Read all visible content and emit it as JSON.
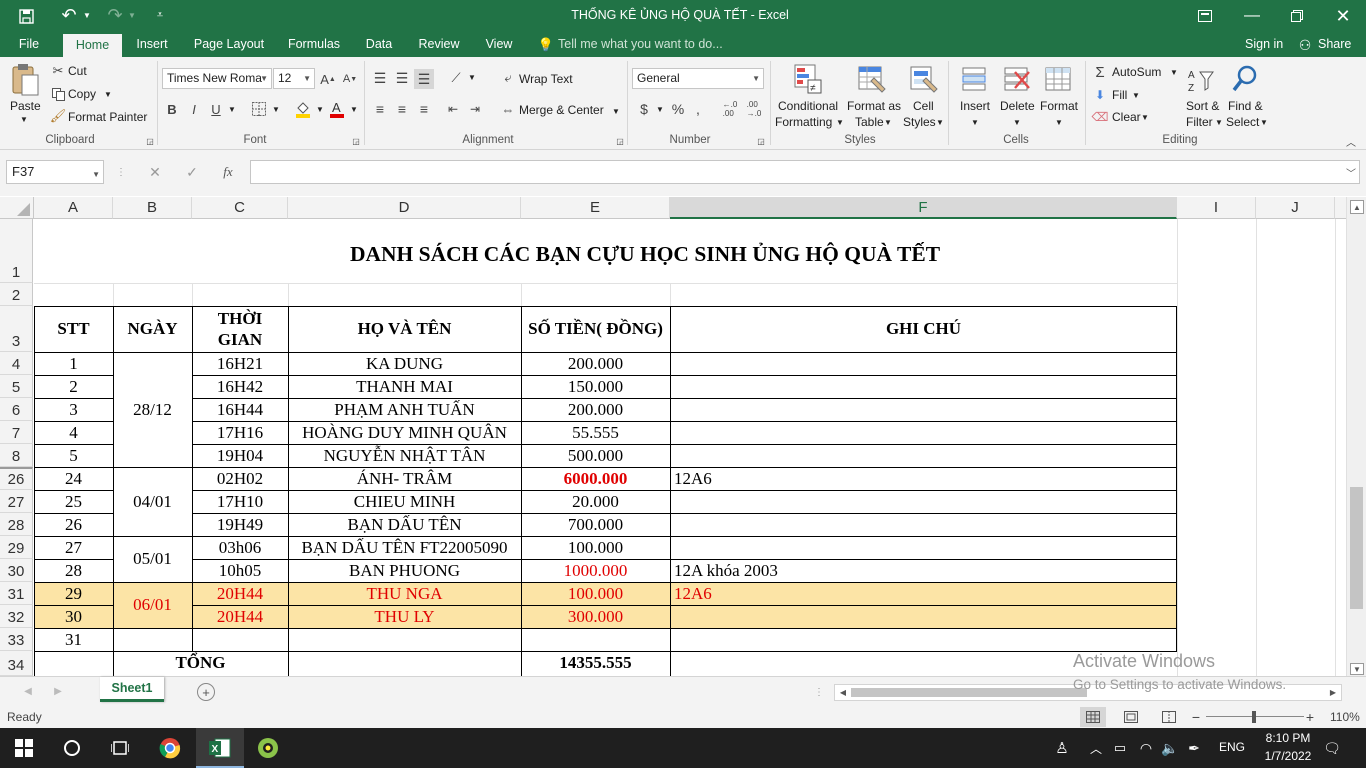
{
  "window": {
    "title": "THỐNG KÊ ỦNG HỘ QUÀ TẾT - Excel"
  },
  "tabs": [
    "File",
    "Home",
    "Insert",
    "Page Layout",
    "Formulas",
    "Data",
    "Review",
    "View"
  ],
  "tell_me": "Tell me what you want to do...",
  "signin": "Sign in",
  "share": "Share",
  "ribbon": {
    "paste": "Paste",
    "cut": "Cut",
    "copy": "Copy",
    "format_painter": "Format Painter",
    "clipboard": "Clipboard",
    "font_name": "Times New Roma",
    "font_size": "12",
    "font": "Font",
    "bold": "B",
    "italic": "I",
    "underline": "U",
    "wrap_text": "Wrap Text",
    "merge_center": "Merge & Center",
    "alignment": "Alignment",
    "number_format": "General",
    "number": "Number",
    "conditional_formatting_1": "Conditional",
    "conditional_formatting_2": "Formatting",
    "format_as_table_1": "Format as",
    "format_as_table_2": "Table",
    "cell_styles_1": "Cell",
    "cell_styles_2": "Styles",
    "styles": "Styles",
    "insert": "Insert",
    "delete": "Delete",
    "format": "Format",
    "cells": "Cells",
    "autosum": "AutoSum",
    "fill": "Fill",
    "clear": "Clear",
    "sort_filter_1": "Sort &",
    "sort_filter_2": "Filter",
    "find_select_1": "Find &",
    "find_select_2": "Select",
    "editing": "Editing"
  },
  "formula_bar": {
    "name_box": "F37",
    "fx": "fx",
    "value": ""
  },
  "columns": [
    "A",
    "B",
    "C",
    "D",
    "E",
    "F",
    "I",
    "J"
  ],
  "rows": [
    "1",
    "2",
    "3",
    "4",
    "5",
    "6",
    "7",
    "8",
    "26",
    "27",
    "28",
    "29",
    "30",
    "31",
    "32",
    "33",
    "34"
  ],
  "sheet": {
    "title": "DANH SÁCH CÁC BẠN CỰU HỌC SINH ỦNG HỘ QUÀ TẾT",
    "headers": {
      "stt": "STT",
      "ngay": "NGÀY",
      "thoigian_1": "THỜI",
      "thoigian_2": "GIAN",
      "hoten": "HỌ VÀ TÊN",
      "sotien": "SỐ TIỀN( ĐỒNG)",
      "ghichu": "GHI CHÚ"
    },
    "dates": {
      "d1": "28/12",
      "d2": "04/01",
      "d3": "05/01",
      "d4": "06/01"
    },
    "data_rows": [
      {
        "stt": "1",
        "time": "16H21",
        "name": "KA DUNG",
        "amount": "200.000",
        "note": ""
      },
      {
        "stt": "2",
        "time": "16H42",
        "name": "THANH MAI",
        "amount": "150.000",
        "note": ""
      },
      {
        "stt": "3",
        "time": "16H44",
        "name": "PHẠM ANH TUẤN",
        "amount": "200.000",
        "note": ""
      },
      {
        "stt": "4",
        "time": "17H16",
        "name": "HOÀNG DUY MINH QUÂN",
        "amount": "55.555",
        "note": ""
      },
      {
        "stt": "5",
        "time": "19H04",
        "name": "NGUYỄN NHẬT TÂN",
        "amount": "500.000",
        "note": ""
      },
      {
        "stt": "24",
        "time": "02H02",
        "name": "ÁNH- TRÂM",
        "amount": "6000.000",
        "note": "12A6"
      },
      {
        "stt": "25",
        "time": "17H10",
        "name": "CHIEU MINH",
        "amount": "20.000",
        "note": ""
      },
      {
        "stt": "26",
        "time": "19H49",
        "name": "BẠN DẤU TÊN",
        "amount": "700.000",
        "note": ""
      },
      {
        "stt": "27",
        "time": "03h06",
        "name": "BẠN DẤU TÊN FT22005090",
        "amount": "100.000",
        "note": ""
      },
      {
        "stt": "28",
        "time": "10h05",
        "name": "BAN PHUONG",
        "amount": "1000.000",
        "note": "12A khóa 2003"
      },
      {
        "stt": "29",
        "time": "20H44",
        "name": "THU NGA",
        "amount": "100.000",
        "note": "12A6"
      },
      {
        "stt": "30",
        "time": "20H44",
        "name": "THU LY",
        "amount": "300.000",
        "note": ""
      },
      {
        "stt": "31",
        "time": "",
        "name": "",
        "amount": "",
        "note": ""
      }
    ],
    "total_label": "TỔNG",
    "total_value": "14355.555",
    "highlight_color": "#fce4a6",
    "red_color": "#e00000"
  },
  "sheet_tab": "Sheet1",
  "status": {
    "ready": "Ready",
    "zoom": "110%"
  },
  "watermark": {
    "line1": "Activate Windows",
    "line2": "Go to Settings to activate Windows."
  },
  "taskbar": {
    "lang": "ENG",
    "time": "8:10 PM",
    "date": "1/7/2022"
  },
  "accent": "#217346"
}
